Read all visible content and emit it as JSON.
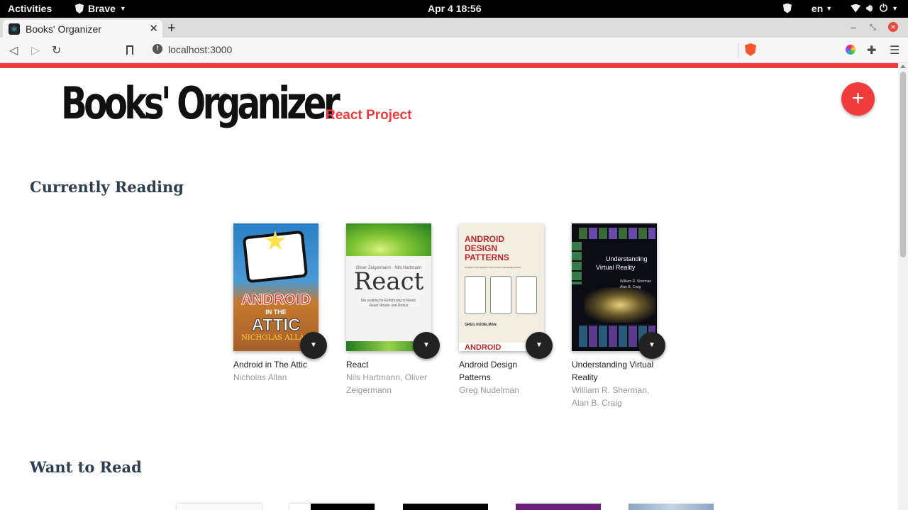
{
  "system_bar": {
    "activities": "Activities",
    "app_name": "Brave",
    "clock": "Apr 4  18:56",
    "language": "en"
  },
  "browser": {
    "tab_title": "Books' Organizer",
    "url": "localhost:3000"
  },
  "header": {
    "title": "Books' Organizer",
    "subtitle": "React Project",
    "add_button": "+"
  },
  "shelves": {
    "currently_reading": {
      "title": "Currently Reading",
      "books": [
        {
          "title": "Android in The Attic",
          "authors": "Nicholas Allan"
        },
        {
          "title": "React",
          "authors": "Nils Hartmann, Oliver Zeigermann"
        },
        {
          "title": "Android Design Patterns",
          "authors": "Greg Nudelman"
        },
        {
          "title": "Understanding Virtual Reality",
          "authors": "William R. Sherman, Alan B. Craig"
        }
      ]
    },
    "want_to_read": {
      "title": "Want to Read"
    }
  },
  "covers": {
    "android_attic": {
      "line1": "ANDROID",
      "line2": "IN THE",
      "line3": "ATTIC",
      "line4": "NICHOLAS ALLAN"
    },
    "react": {
      "authors_line": "Oliver Zeigermann · Nils Hartmann",
      "title": "React",
      "blurb": "Die praktische Einführung in React, React Router und Redux"
    },
    "android_design": {
      "title1": "ANDROID",
      "title2": "DESIGN",
      "title3": "PATTERNS",
      "tagline": "INTERACTION DESIGN SOLUTIONS FOR DEVELOPERS",
      "author": "GREG NUDELMAN",
      "footer": "ANDROID"
    },
    "vr": {
      "title1": "Understanding",
      "title2": "Virtual Reality",
      "author1": "William R. Sherman",
      "author2": "Alan B. Craig"
    }
  },
  "colors": {
    "accent": "#f03c3c",
    "shelf_title": "#2d3e50"
  }
}
